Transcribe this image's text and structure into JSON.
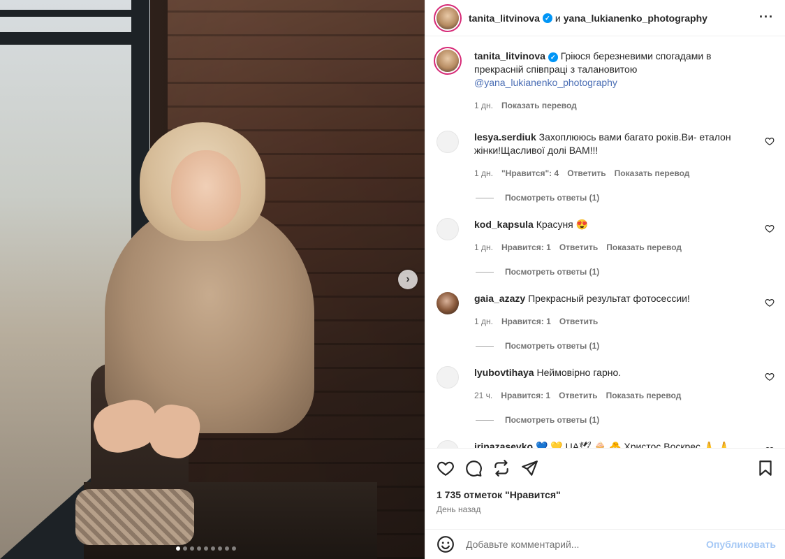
{
  "post": {
    "author": "tanita_litvinova",
    "and_text": "и",
    "coauthor": "yana_lukianenko_photography",
    "more_icon": "ellipsis-icon",
    "caption": {
      "username": "tanita_litvinova",
      "text": "Гріюся березневими спогадами в прекрасній співпраці з талановитою",
      "mention": "@yana_lukianenko_photography",
      "time": "1 дн.",
      "translate": "Показать перевод"
    }
  },
  "carousel": {
    "next_icon": "chevron-right-icon",
    "dots_total": 9,
    "active_dot": 0
  },
  "comments": [
    {
      "username": "lesya.serdiuk",
      "text": "Захоплююсь вами багато років.Ви- еталон жінки!Щасливої долі ВАМ!!!",
      "time": "1 дн.",
      "likes": "\"Нравится\": 4",
      "reply": "Ответить",
      "translate": "Показать перевод",
      "replies": "Посмотреть ответы (1)"
    },
    {
      "username": "kod_kapsula",
      "text": "Красуня 😍",
      "time": "1 дн.",
      "likes": "Нравится: 1",
      "reply": "Ответить",
      "translate": "Показать перевод",
      "replies": "Посмотреть ответы (1)"
    },
    {
      "username": "gaia_azazy",
      "text": "Прекрасный результат фотосессии!",
      "time": "1 дн.",
      "likes": "Нравится: 1",
      "reply": "Ответить",
      "translate": "",
      "replies": "Посмотреть ответы (1)"
    },
    {
      "username": "lyubovtihaya",
      "text": "Неймовірно гарно.",
      "time": "21 ч.",
      "likes": "Нравится: 1",
      "reply": "Ответить",
      "translate": "Показать перевод",
      "replies": "Посмотреть ответы (1)"
    },
    {
      "username": "irinazasevko",
      "text": "💙 💛 UA🕊 🧁 🐣 Христос Воскрес 🙏 🙏",
      "time": "",
      "likes": "",
      "reply": "",
      "translate": "",
      "replies": ""
    }
  ],
  "actions": {
    "like_icon": "heart-icon",
    "comment_icon": "comment-bubble-icon",
    "repost_icon": "repost-icon",
    "share_icon": "send-icon",
    "save_icon": "bookmark-icon",
    "likes_count": "1 735 отметок \"Нравится\"",
    "posted_ago": "День назад"
  },
  "add_comment": {
    "emoji_icon": "smiley-icon",
    "placeholder": "Добавьте комментарий...",
    "post_label": "Опубликовать"
  },
  "colors": {
    "link": "#4c6fb5",
    "verified": "#0095f6",
    "post_button_disabled": "#a5c8f5",
    "secondary_text": "#737373"
  }
}
